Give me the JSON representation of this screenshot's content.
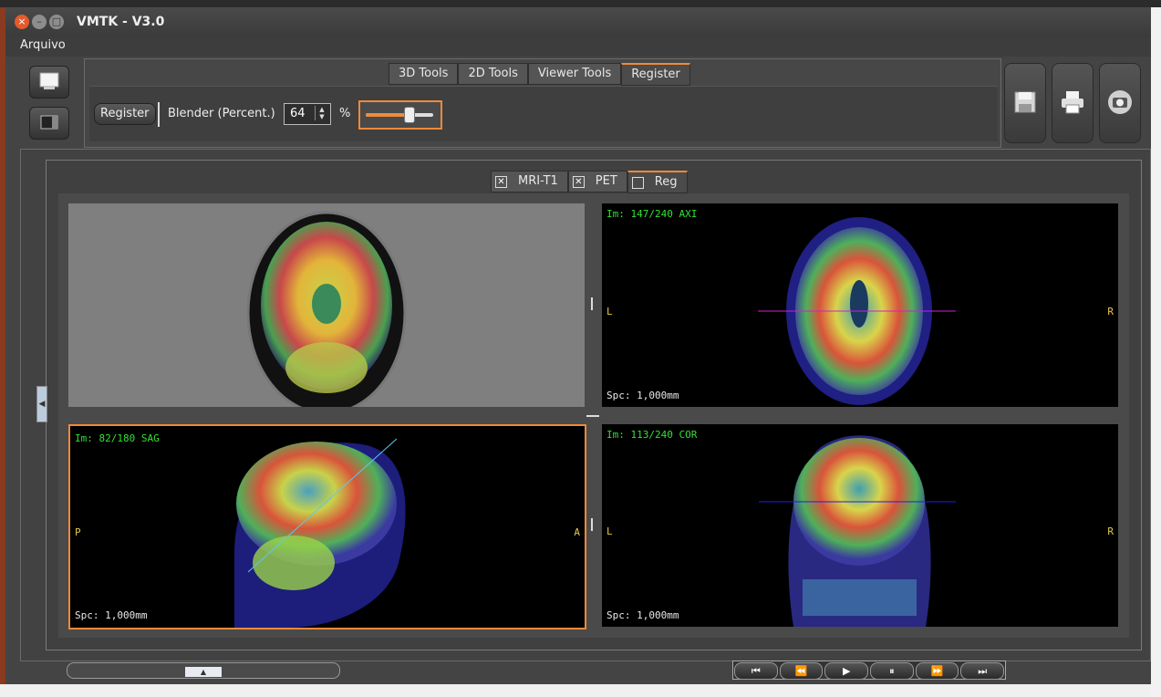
{
  "window": {
    "title": "VMTK - V3.0",
    "close_glyph": "×",
    "min_glyph": "–",
    "max_glyph": "□"
  },
  "menu": {
    "items": [
      "Arquivo"
    ]
  },
  "toolbar": {
    "tabs": [
      "3D Tools",
      "2D Tools",
      "Viewer Tools",
      "Register"
    ],
    "active_tab": "Register",
    "register_button": "Register",
    "blender_label": "Blender (Percent.)",
    "blender_value": "64",
    "percent_symbol": "%",
    "slider_fraction": 0.64,
    "side_icons": [
      "file-icon",
      "folder-icon"
    ],
    "action_icons": [
      "floppy-disk-icon",
      "printer-icon",
      "camera-icon"
    ]
  },
  "layers": {
    "tabs": [
      {
        "label": "MRI-T1",
        "checked": true
      },
      {
        "label": "PET",
        "checked": true
      },
      {
        "label": "Reg",
        "checked": false
      }
    ],
    "active": "Reg",
    "check_glyph": "✕"
  },
  "views": {
    "axi": {
      "info": "Im: 147/240 AXI",
      "left": "L",
      "right": "R",
      "spacing": "Spc: 1,000mm"
    },
    "sag": {
      "info": "Im: 82/180 SAG",
      "left": "P",
      "right": "A",
      "spacing": "Spc: 1,000mm"
    },
    "cor": {
      "info": "Im: 113/240 COR",
      "left": "L",
      "right": "R",
      "spacing": "Spc: 1,000mm"
    }
  },
  "player": {
    "buttons": [
      "⏮",
      "⏪",
      "▶",
      "⏸",
      "⏩",
      "⏭"
    ],
    "names": [
      "first-frame-button",
      "rewind-button",
      "play-button",
      "pause-button",
      "fast-forward-button",
      "last-frame-button"
    ]
  },
  "colors": {
    "accent": "#f08a3a",
    "overlay_green": "#33e033",
    "overlay_yellow": "#e6c84a",
    "axi_crosshair": "#d21ed2",
    "cor_crosshair": "#2020e0",
    "sag_crosshair": "#60c8e8"
  }
}
